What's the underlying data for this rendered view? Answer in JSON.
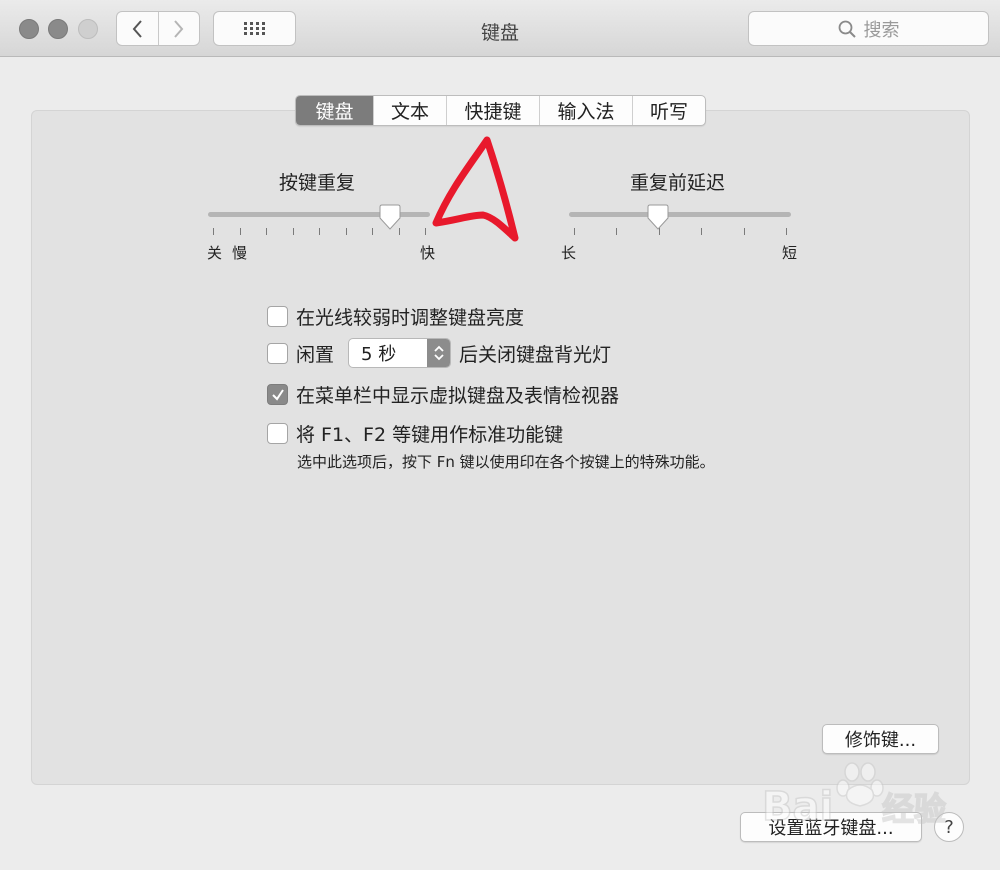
{
  "window": {
    "title": "键盘",
    "search_placeholder": "搜索"
  },
  "tabs": [
    {
      "label": "键盘",
      "selected": true
    },
    {
      "label": "文本",
      "selected": false
    },
    {
      "label": "快捷键",
      "selected": false
    },
    {
      "label": "输入法",
      "selected": false
    },
    {
      "label": "听写",
      "selected": false
    }
  ],
  "key_repeat": {
    "label": "按键重复",
    "left_labels": [
      "关",
      "慢"
    ],
    "right_label": "快",
    "value_fraction": 0.82
  },
  "delay_until_repeat": {
    "label": "重复前延迟",
    "left_label": "长",
    "right_label": "短",
    "value_fraction": 0.4
  },
  "options": {
    "adjust_brightness": {
      "label": "在光线较弱时调整键盘亮度",
      "checked": false
    },
    "backlight_off": {
      "prefix": "闲置",
      "value": "5 秒",
      "suffix": "后关闭键盘背光灯",
      "checked": false
    },
    "show_viewer": {
      "label": "在菜单栏中显示虚拟键盘及表情检视器",
      "checked": true
    },
    "fn_keys": {
      "label": "将 F1、F2 等键用作标准功能键",
      "checked": false,
      "description": "选中此选项后，按下 Fn 键以使用印在各个按键上的特殊功能。"
    }
  },
  "buttons": {
    "modifier_keys": "修饰键...",
    "bluetooth_keyboard": "设置蓝牙键盘...",
    "help": "?"
  },
  "watermark": {
    "text_latin": "Bai",
    "text_cn": "经验"
  },
  "colors": {
    "annotation": "#e8192c",
    "selected_tab": "#7c7c7c"
  }
}
